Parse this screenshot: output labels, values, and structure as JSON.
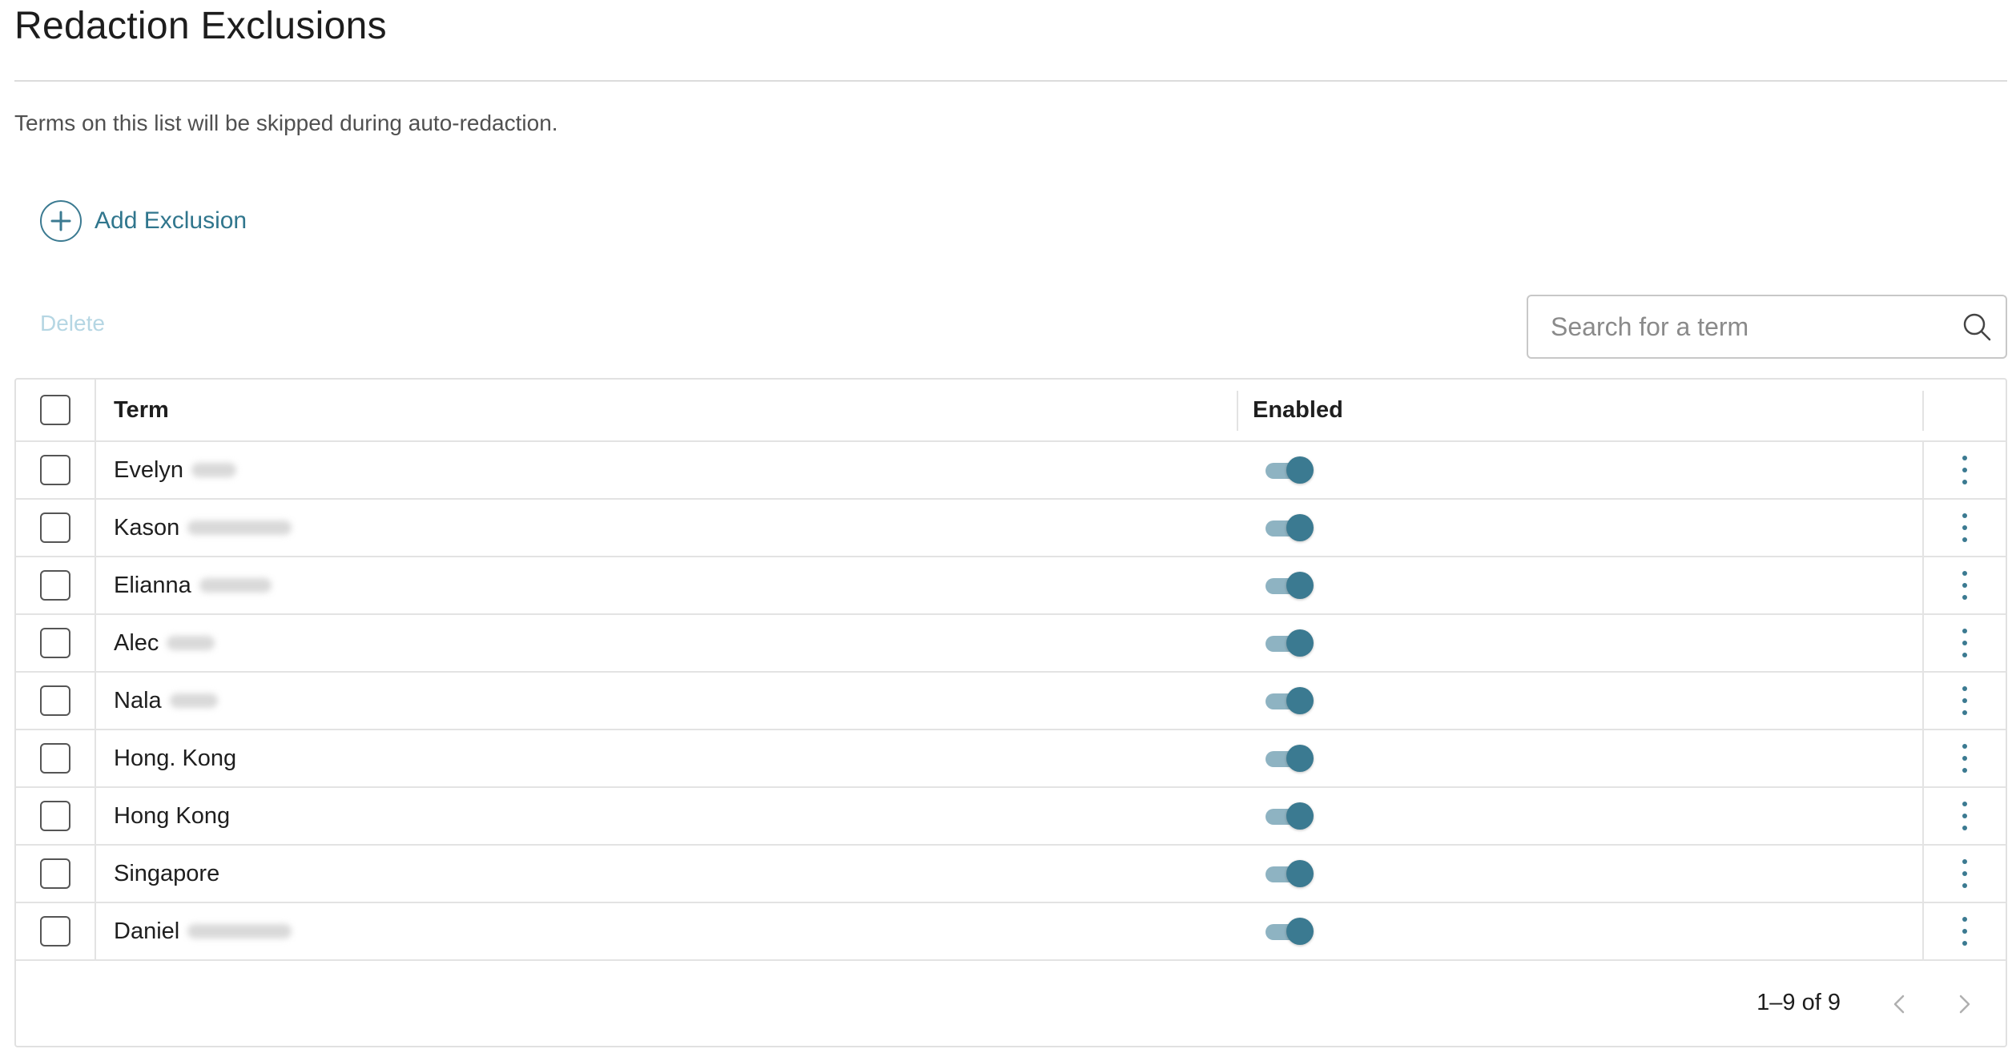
{
  "page": {
    "title": "Redaction Exclusions",
    "subtitle": "Terms on this list will be skipped during auto-redaction."
  },
  "actions": {
    "add_label": "Add Exclusion",
    "delete_label": "Delete"
  },
  "search": {
    "placeholder": "Search for a term",
    "value": ""
  },
  "table": {
    "columns": {
      "term": "Term",
      "enabled": "Enabled"
    },
    "rows": [
      {
        "term": "Evelyn",
        "enabled": true
      },
      {
        "term": "Kason",
        "enabled": true
      },
      {
        "term": "Elianna",
        "enabled": true
      },
      {
        "term": "Alec",
        "enabled": true
      },
      {
        "term": "Nala",
        "enabled": true
      },
      {
        "term": "Hong. Kong",
        "enabled": true
      },
      {
        "term": "Hong Kong",
        "enabled": true
      },
      {
        "term": "Singapore",
        "enabled": true
      },
      {
        "term": "Daniel",
        "enabled": true
      }
    ]
  },
  "pagination": {
    "range_text": "1–9 of 9"
  },
  "colors": {
    "accent": "#3b7a91",
    "accent_text": "#30768d",
    "disabled_text": "#b5d6e3",
    "toggle_track": "#8eb3c2",
    "border": "#e3e3e3"
  },
  "icons": {
    "add": "plus-circle-icon",
    "search": "search-icon",
    "row_menu": "more-vertical-icon",
    "prev": "chevron-left-icon",
    "next": "chevron-right-icon"
  }
}
